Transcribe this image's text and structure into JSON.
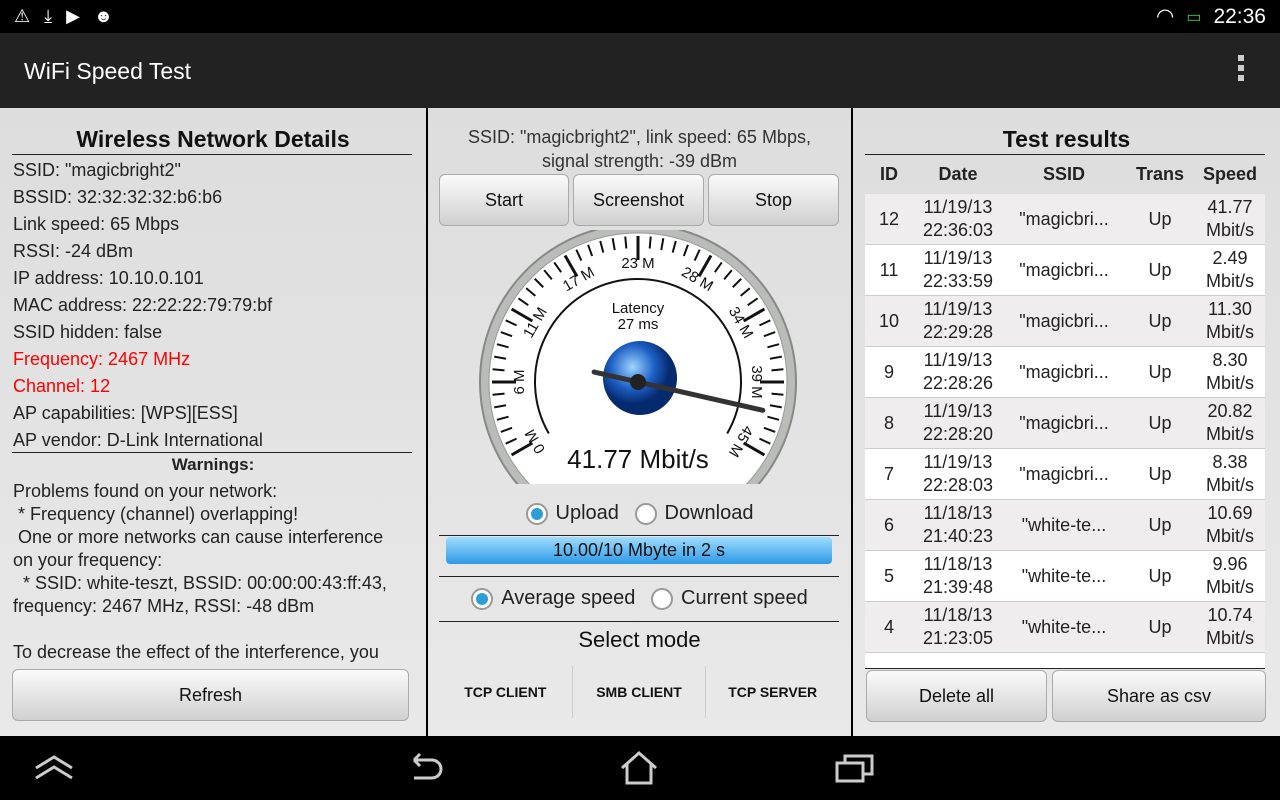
{
  "status_bar": {
    "time": "22:36",
    "icons": [
      "warning-icon",
      "download-icon",
      "play-store-icon",
      "android-icon"
    ]
  },
  "app": {
    "title": "WiFi Speed Test"
  },
  "details": {
    "title": "Wireless Network Details",
    "lines": [
      "SSID: \"magicbright2\"",
      "BSSID: 32:32:32:32:b6:b6",
      "Link speed: 65 Mbps",
      "RSSI: -24 dBm",
      "IP address: 10.10.0.101",
      "MAC address: 22:22:22:79:79:bf",
      "SSID hidden: false"
    ],
    "red_lines": [
      "Frequency: 2467 MHz",
      "Channel: 12"
    ],
    "lines2": [
      "AP capabilities: [WPS][ESS]",
      "AP vendor: D-Link International"
    ],
    "warnings_title": "Warnings:",
    "warnings": [
      "Problems found on your network:",
      " * Frequency (channel) overlapping!",
      " One or more networks can cause interference",
      "on your frequency:",
      "  * SSID: white-teszt, BSSID: 00:00:00:43:ff:43,",
      "frequency: 2467 MHz, RSSI: -48 dBm",
      "",
      "To decrease the effect of the interference, you"
    ],
    "refresh": "Refresh"
  },
  "test": {
    "info1": "SSID: \"magicbright2\", link speed: 65 Mbps,",
    "info2": "signal strength: -39 dBm",
    "start": "Start",
    "screenshot": "Screenshot",
    "stop": "Stop",
    "gauge": {
      "labels": [
        "0 M",
        "6 M",
        "11 M",
        "17 M",
        "23 M",
        "28 M",
        "34 M",
        "39 M",
        "45 M"
      ],
      "max": 45,
      "value": 41.77,
      "latency_label": "Latency",
      "latency": "27 ms",
      "speed": "41.77 Mbit/s"
    },
    "upload": "Upload",
    "download": "Download",
    "progress_text": "10.00/10 Mbyte in 2 s",
    "progress": 1.0,
    "average": "Average speed",
    "current": "Current speed",
    "mode_title": "Select mode",
    "modes": [
      "TCP CLIENT",
      "SMB CLIENT",
      "TCP SERVER"
    ]
  },
  "results": {
    "title": "Test results",
    "headers": [
      "ID",
      "Date",
      "SSID",
      "Trans",
      "Speed"
    ],
    "rows": [
      [
        "12",
        "11/19/13",
        "22:36:03",
        "\"magicbri...",
        "Up",
        "41.77",
        "Mbit/s"
      ],
      [
        "11",
        "11/19/13",
        "22:33:59",
        "\"magicbri...",
        "Up",
        "2.49",
        "Mbit/s"
      ],
      [
        "10",
        "11/19/13",
        "22:29:28",
        "\"magicbri...",
        "Up",
        "11.30",
        "Mbit/s"
      ],
      [
        "9",
        "11/19/13",
        "22:28:26",
        "\"magicbri...",
        "Up",
        "8.30",
        "Mbit/s"
      ],
      [
        "8",
        "11/19/13",
        "22:28:20",
        "\"magicbri...",
        "Up",
        "20.82",
        "Mbit/s"
      ],
      [
        "7",
        "11/19/13",
        "22:28:03",
        "\"magicbri...",
        "Up",
        "8.38",
        "Mbit/s"
      ],
      [
        "6",
        "11/18/13",
        "21:40:23",
        "\"white-te...",
        "Up",
        "10.69",
        "Mbit/s"
      ],
      [
        "5",
        "11/18/13",
        "21:39:48",
        "\"white-te...",
        "Up",
        "9.96",
        "Mbit/s"
      ],
      [
        "4",
        "11/18/13",
        "21:23:05",
        "\"white-te...",
        "Up",
        "10.74",
        "Mbit/s"
      ]
    ],
    "delete_all": "Delete all",
    "share": "Share as csv"
  }
}
